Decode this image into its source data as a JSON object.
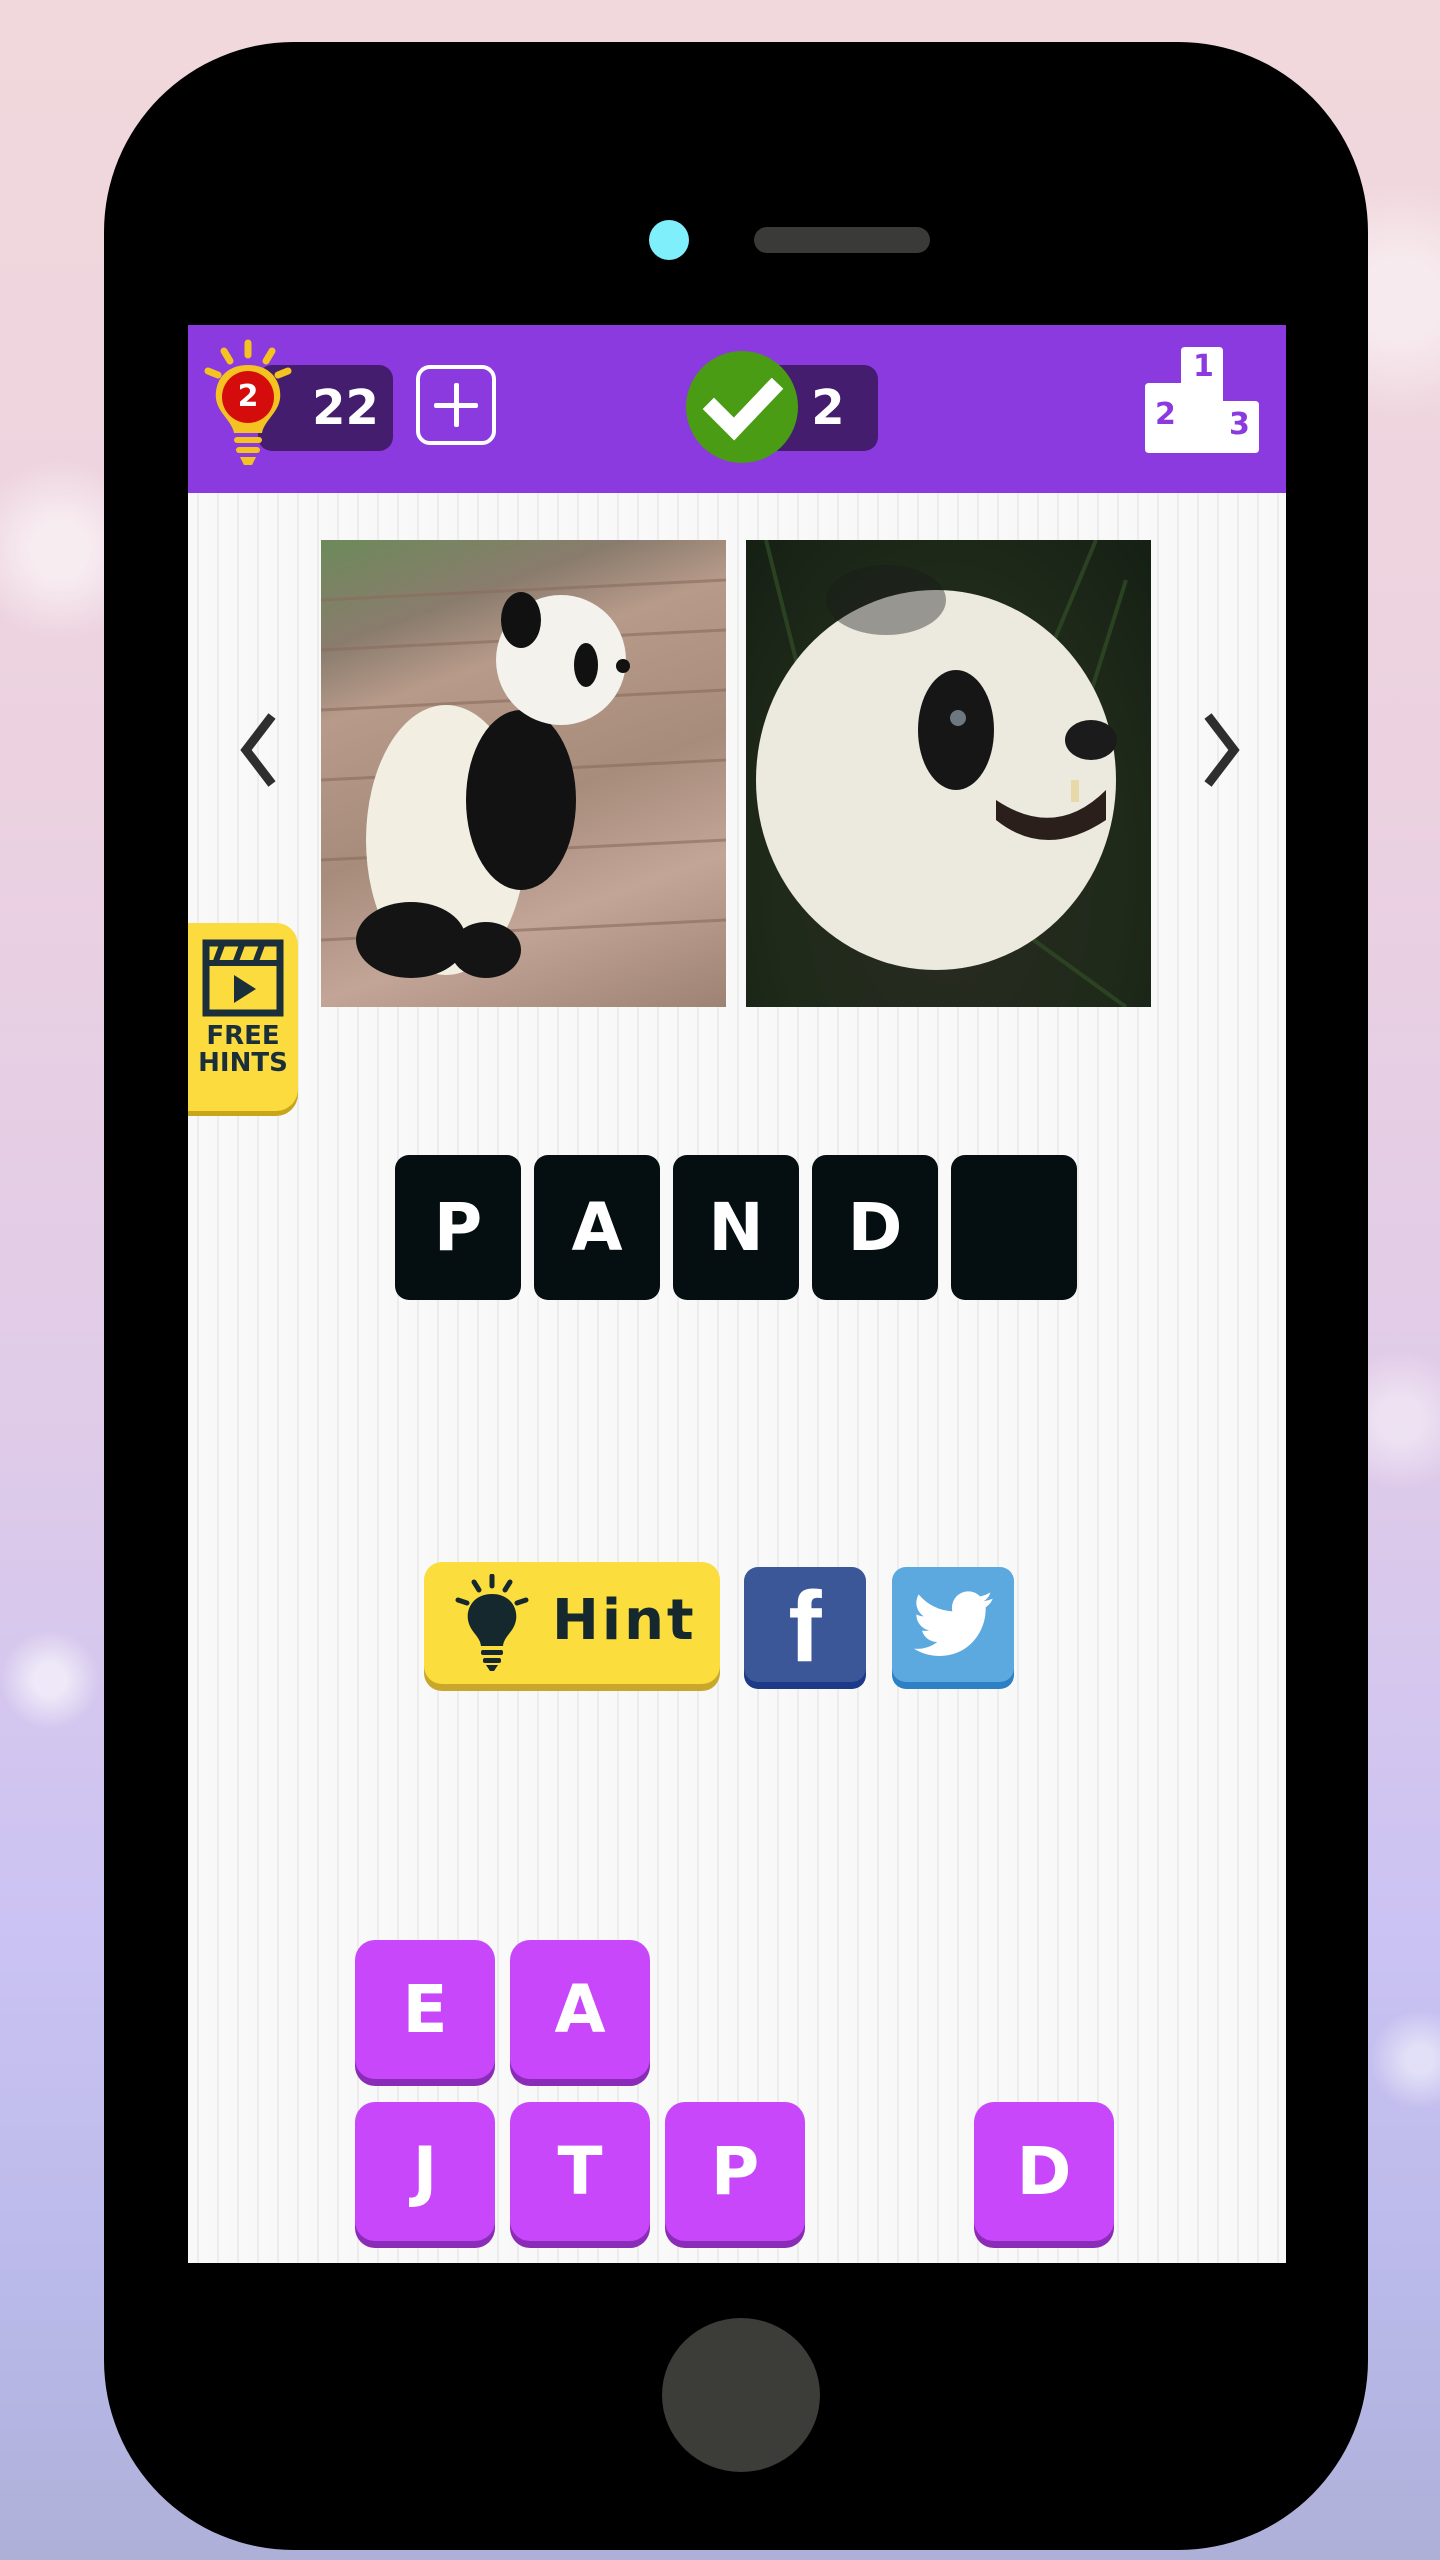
{
  "header": {
    "hints_badge": "2",
    "hints_count": "22",
    "solved_count": "2",
    "leaderboard_ranks": [
      "1",
      "2",
      "3"
    ]
  },
  "puzzle": {
    "images": [
      {
        "alt": "Panda cub climbing on wooden logs"
      },
      {
        "alt": "Close-up of giant panda face among bamboo"
      }
    ],
    "answer_slots": [
      "P",
      "A",
      "N",
      "D",
      ""
    ]
  },
  "free_hints": {
    "label_line1": "FREE",
    "label_line2": "HINTS"
  },
  "actions": {
    "hint_label": "Hint",
    "facebook_glyph": "f"
  },
  "letter_tiles": {
    "row1": [
      "E",
      "A"
    ],
    "row2": [
      "J",
      "T",
      "P",
      "D"
    ]
  },
  "colors": {
    "topbar": "#8a3ade",
    "pill": "#441d6e",
    "check_green": "#4a9c14",
    "tile_purple": "#c947fb",
    "hint_yellow": "#fbdd3d",
    "facebook_blue": "#3b5798",
    "twitter_blue": "#5ca9df",
    "answer_slot": "#050f12"
  }
}
